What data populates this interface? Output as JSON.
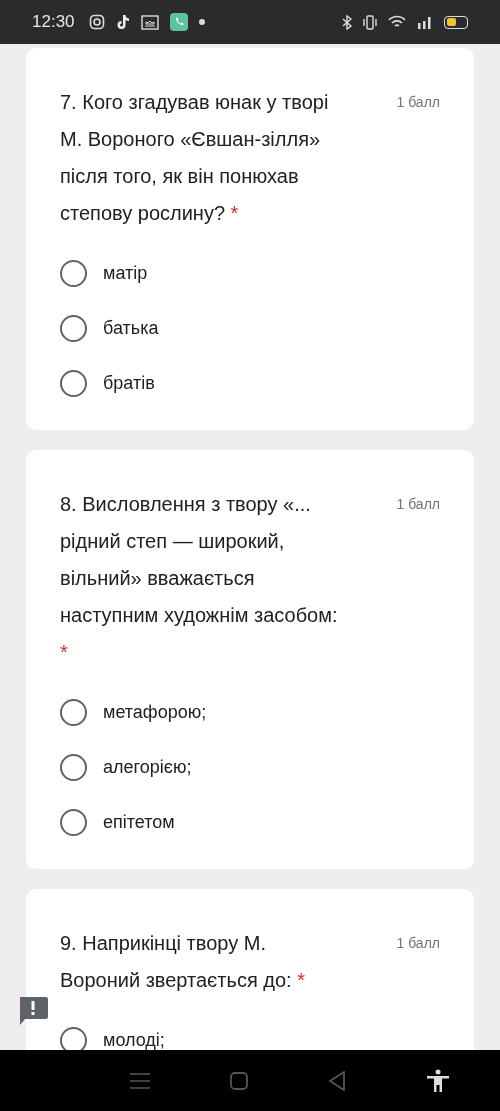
{
  "status_bar": {
    "time": "12:30"
  },
  "questions": [
    {
      "text": "7. Кого згадував юнак у творі М. Вороного «Євшан-зілля» після того, як він понюхав степову рослину?",
      "points": "1 балл",
      "required": true,
      "asterisk": "*",
      "options": [
        {
          "label": "матір",
          "selected": false
        },
        {
          "label": "батька",
          "selected": false
        },
        {
          "label": "братів",
          "selected": false
        }
      ]
    },
    {
      "text": "8. Висловлення з твору «... рідний степ — широкий, вільний» вважається наступним художнім засобом:",
      "points": "1 балл",
      "required": true,
      "asterisk": "*",
      "options": [
        {
          "label": "метафорою;",
          "selected": false
        },
        {
          "label": "алегорією;",
          "selected": false
        },
        {
          "label": "епітетом",
          "selected": false
        }
      ]
    },
    {
      "text": "9. Наприкінці твору М. Вороний звертається до:",
      "points": "1 балл",
      "required": true,
      "asterisk": "*",
      "options": [
        {
          "label": "молоді;",
          "selected": false
        }
      ]
    }
  ]
}
